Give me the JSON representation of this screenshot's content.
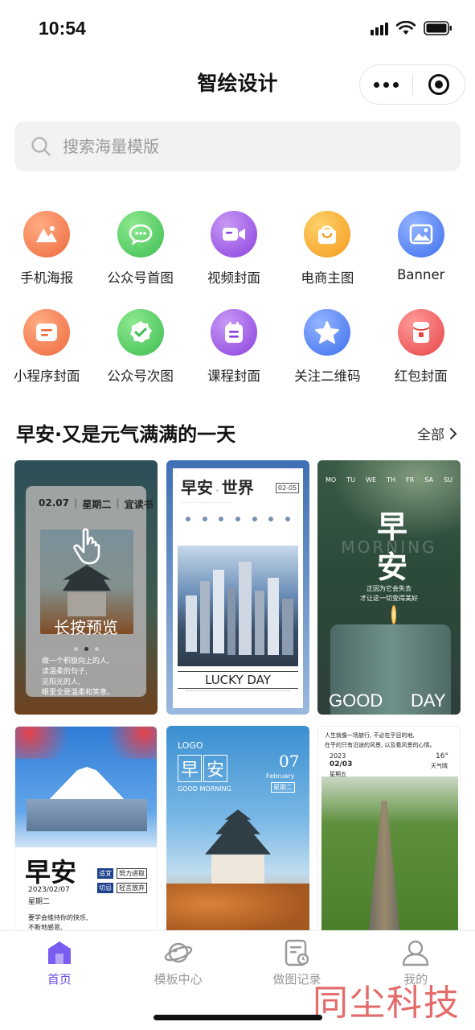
{
  "status": {
    "time": "10:54"
  },
  "nav": {
    "title": "智绘设计"
  },
  "search": {
    "placeholder": "搜索海量模版"
  },
  "categories": [
    {
      "label": "手机海报",
      "icon": "mountain-icon",
      "color": "#f07a4e"
    },
    {
      "label": "公众号首图",
      "icon": "wechat-icon",
      "color": "#4fc65e"
    },
    {
      "label": "视频封面",
      "icon": "video-icon",
      "color": "#9b52e3"
    },
    {
      "label": "电商主图",
      "icon": "shopping-bag-icon",
      "color": "#f6a425"
    },
    {
      "label": "Banner",
      "icon": "image-icon",
      "color": "#4f7ef2"
    },
    {
      "label": "小程序封面",
      "icon": "document-icon",
      "color": "#f07a4e"
    },
    {
      "label": "公众号次图",
      "icon": "badge-check-icon",
      "color": "#4fc65e"
    },
    {
      "label": "课程封面",
      "icon": "calendar-icon",
      "color": "#9b52e3"
    },
    {
      "label": "关注二维码",
      "icon": "star-icon",
      "color": "#4f7ef2"
    },
    {
      "label": "红包封面",
      "icon": "red-envelope-icon",
      "color": "#ea4f4f"
    }
  ],
  "section": {
    "title": "早安·又是元气满满的一天",
    "more": "全部"
  },
  "cards": {
    "c1": {
      "date": "02.07",
      "weekday": "星期二",
      "tag": "宜读书",
      "overlay": "长按预览",
      "lines": [
        "做一个积极向上的人,",
        "读温柔的句子,",
        "见阳光的人,",
        "眼里全是温柔和笑意。"
      ]
    },
    "c2": {
      "title": "早安",
      "title2": "世界",
      "date": "02-05",
      "caption": "LUCKY DAY"
    },
    "c3": {
      "days": [
        "MO",
        "TU",
        "WE",
        "TH",
        "FR",
        "SA",
        "SU"
      ],
      "zao": "早",
      "an": "安",
      "morning": "MORNING",
      "line1": "正因为它会失去",
      "line2": "才让这一切变得美好",
      "good": "GOOD",
      "day": "DAY"
    },
    "c4": {
      "title": "早安",
      "date": "2023/02/07",
      "weekday": "星期二",
      "yi": "适宜",
      "yi_text": "努力进取",
      "ji": "切忌",
      "ji_text": "轻言放弃",
      "line1": "要学会维持你的快乐,",
      "line2": "不断地感恩,"
    },
    "c5": {
      "logo": "LOGO",
      "zao": "早",
      "an": "安",
      "day": "07",
      "month": "February",
      "weekday": "星期二",
      "sub": "GOOD MORNING"
    },
    "c6": {
      "quote1": "人生就像一场旅行, 不必在乎目的地,",
      "quote2": "在乎的只有沿途的风景, 以及看风景的心情。",
      "year": "2023",
      "date": "02/03",
      "weekday": "星期五",
      "temp": "16°",
      "weather": "天气晴"
    }
  },
  "tabs": [
    {
      "label": "首页",
      "icon": "home-icon",
      "active": true
    },
    {
      "label": "模板中心",
      "icon": "planet-icon",
      "active": false
    },
    {
      "label": "做图记录",
      "icon": "record-icon",
      "active": false
    },
    {
      "label": "我的",
      "icon": "user-icon",
      "active": false
    }
  ],
  "watermark": "同尘科技",
  "colors": {
    "accent": "#6a4ee6",
    "search_bg": "#f1f2f4"
  }
}
